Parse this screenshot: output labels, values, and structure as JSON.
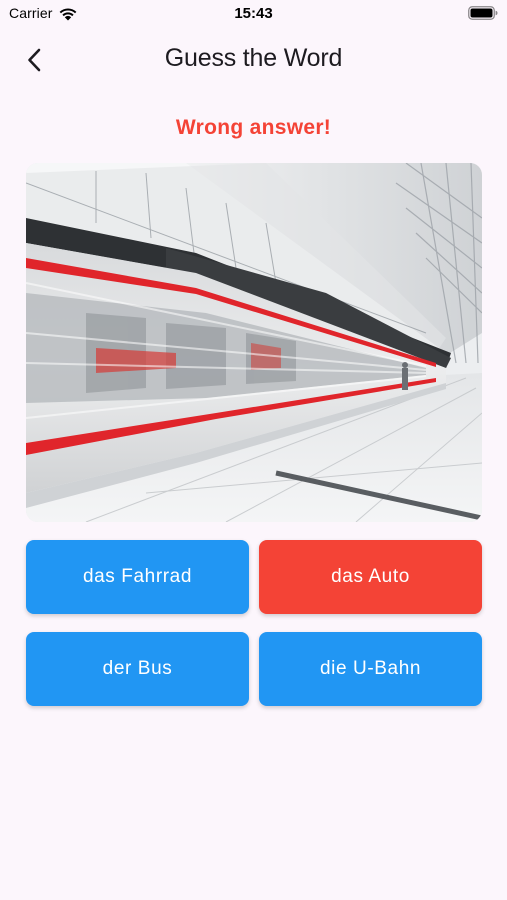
{
  "status_bar": {
    "carrier": "Carrier",
    "time": "15:43",
    "icons": [
      "wifi-icon",
      "battery-icon"
    ]
  },
  "app_bar": {
    "title": "Guess the Word",
    "back_icon": "chevron-left-icon"
  },
  "feedback": {
    "text": "Wrong answer!",
    "color": "#F44336"
  },
  "image": {
    "subject": "subway-train-in-station",
    "alt": ""
  },
  "answers": [
    {
      "label": "das Fahrrad",
      "color": "#2196F3",
      "state": "default"
    },
    {
      "label": "das Auto",
      "color": "#F44336",
      "state": "wrong"
    },
    {
      "label": "der Bus",
      "color": "#2196F3",
      "state": "default"
    },
    {
      "label": "die U-Bahn",
      "color": "#2196F3",
      "state": "default"
    }
  ],
  "colors": {
    "background": "#FCF6FC",
    "primary": "#2196F3",
    "error": "#F44336"
  }
}
